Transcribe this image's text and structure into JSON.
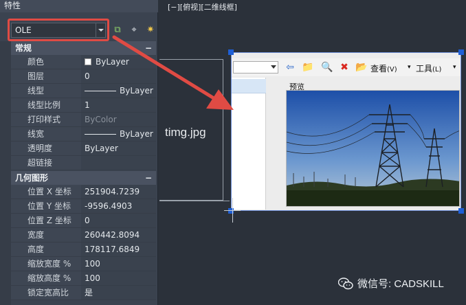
{
  "viewport": {
    "view_label": "[−][俯视][二维线框]",
    "filename": "timg.jpg"
  },
  "palette": {
    "title": "特性",
    "object_type": "OLE",
    "sections": [
      {
        "title": "常规",
        "rows": [
          {
            "key": "颜色",
            "value": "ByLayer",
            "kind": "color"
          },
          {
            "key": "图层",
            "value": "0"
          },
          {
            "key": "线型",
            "value": "ByLayer",
            "kind": "line"
          },
          {
            "key": "线型比例",
            "value": "1"
          },
          {
            "key": "打印样式",
            "value": "ByColor",
            "kind": "disabled"
          },
          {
            "key": "线宽",
            "value": "ByLayer",
            "kind": "line"
          },
          {
            "key": "透明度",
            "value": "ByLayer"
          },
          {
            "key": "超链接",
            "value": ""
          }
        ]
      },
      {
        "title": "几何图形",
        "rows": [
          {
            "key": "位置 X 坐标",
            "value": "251904.7239"
          },
          {
            "key": "位置 Y 坐标",
            "value": "-9596.4903"
          },
          {
            "key": "位置 Z 坐标",
            "value": "0"
          },
          {
            "key": "宽度",
            "value": "260442.8094"
          },
          {
            "key": "高度",
            "value": "178117.6849"
          },
          {
            "key": "缩放宽度 %",
            "value": "100"
          },
          {
            "key": "缩放高度 %",
            "value": "100"
          },
          {
            "key": "锁定宽高比",
            "value": "是"
          }
        ]
      }
    ],
    "collapse_symbol": "−"
  },
  "ole": {
    "view_label": "查看",
    "view_key": "(V)",
    "tools_label": "工具",
    "tools_key": "(L)",
    "preview_label": "预览"
  },
  "watermark": {
    "text": "微信号: CADSKILL"
  },
  "colors": {
    "highlight": "#e04b44",
    "handle": "#1e5fd6"
  }
}
